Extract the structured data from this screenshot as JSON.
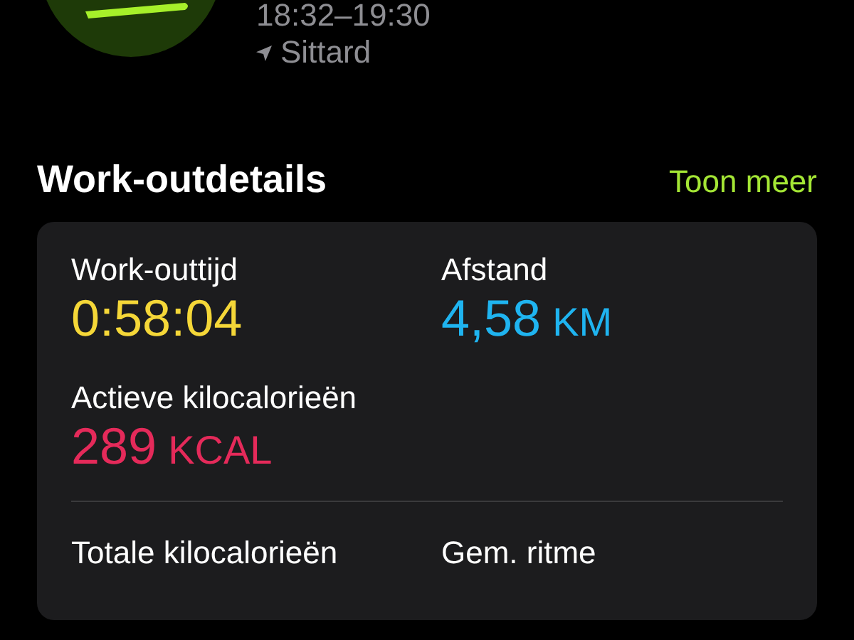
{
  "header": {
    "time_range": "18:32–19:30",
    "location": "Sittard"
  },
  "section": {
    "title": "Work-outdetails",
    "link": "Toon meer"
  },
  "metrics": [
    {
      "label": "Work-outtijd",
      "value": "0:58:04",
      "color": "#f5d738"
    },
    {
      "label": "Afstand",
      "value": "4,58",
      "unit": "KM",
      "color": "#1fb4f0"
    },
    {
      "label": "Actieve kilocalorieën",
      "value": "289",
      "unit": "KCAL",
      "color": "#e52a5a",
      "divider_after": true
    },
    {
      "label": "Totale kilocalorieën"
    },
    {
      "label": "Gem. ritme"
    }
  ]
}
